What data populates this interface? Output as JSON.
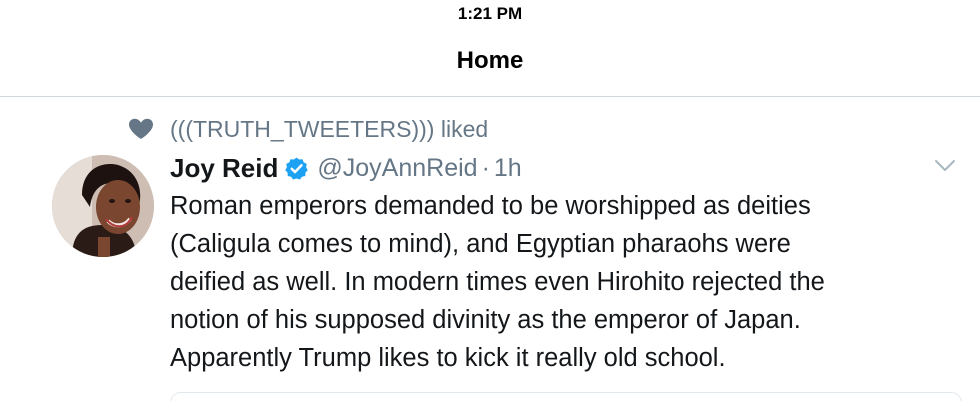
{
  "status_bar": {
    "time": "1:21 PM"
  },
  "nav": {
    "title": "Home"
  },
  "tweet": {
    "context": {
      "icon": "heart-icon",
      "text": "(((TRUTH_TWEETERS))) liked"
    },
    "author": {
      "name": "Joy Reid",
      "verified_icon": "verified-badge-icon",
      "handle": "@JoyAnnReid",
      "separator": "·",
      "time": "1h"
    },
    "text": "Roman emperors demanded to be worshipped as deities\n(Caligula comes to mind), and Egyptian pharaohs were\ndeified as well. In modern times even Hirohito rejected the\nnotion of his supposed divinity as the emperor of Japan.\nApparently Trump likes to kick it really old school.",
    "menu_icon": "chevron-down-icon"
  },
  "colors": {
    "secondary_text": "#657786",
    "primary_text": "#14171a",
    "verified_blue": "#1da1f2",
    "divider": "#cfd6dc"
  }
}
